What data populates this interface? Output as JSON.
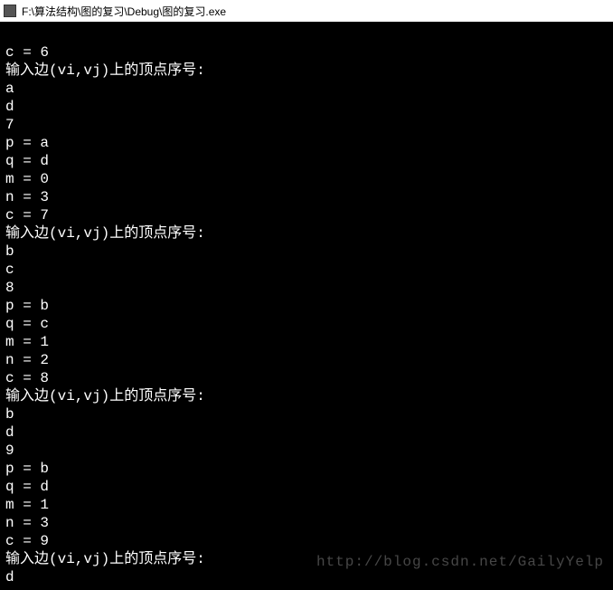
{
  "window": {
    "title": "F:\\算法结构\\图的复习\\Debug\\图的复习.exe"
  },
  "console": {
    "lines": [
      "",
      "c = 6",
      "输入边(vi,vj)上的顶点序号:",
      "a",
      "d",
      "7",
      "p = a",
      "q = d",
      "m = 0",
      "n = 3",
      "c = 7",
      "输入边(vi,vj)上的顶点序号:",
      "b",
      "c",
      "8",
      "p = b",
      "q = c",
      "m = 1",
      "n = 2",
      "c = 8",
      "输入边(vi,vj)上的顶点序号:",
      "b",
      "d",
      "9",
      "p = b",
      "q = d",
      "m = 1",
      "n = 3",
      "c = 9",
      "输入边(vi,vj)上的顶点序号:",
      "d"
    ]
  },
  "watermark": "http://blog.csdn.net/GailyYelp"
}
